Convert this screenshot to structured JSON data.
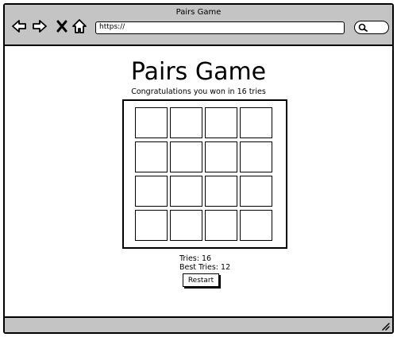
{
  "window": {
    "title": "Pairs Game"
  },
  "toolbar": {
    "url": "https://"
  },
  "page": {
    "heading": "Pairs Game",
    "message": "Congratulations you won in 16 tries"
  },
  "board": {
    "rows": 4,
    "columns": 4
  },
  "stats": {
    "tries": "Tries: 16",
    "best_tries": "Best Tries: 12"
  },
  "controls": {
    "restart_label": "Restart"
  },
  "icons": [
    "back-arrow-icon",
    "forward-arrow-icon",
    "close-icon",
    "home-icon",
    "search-icon",
    "resize-grip-icon"
  ]
}
